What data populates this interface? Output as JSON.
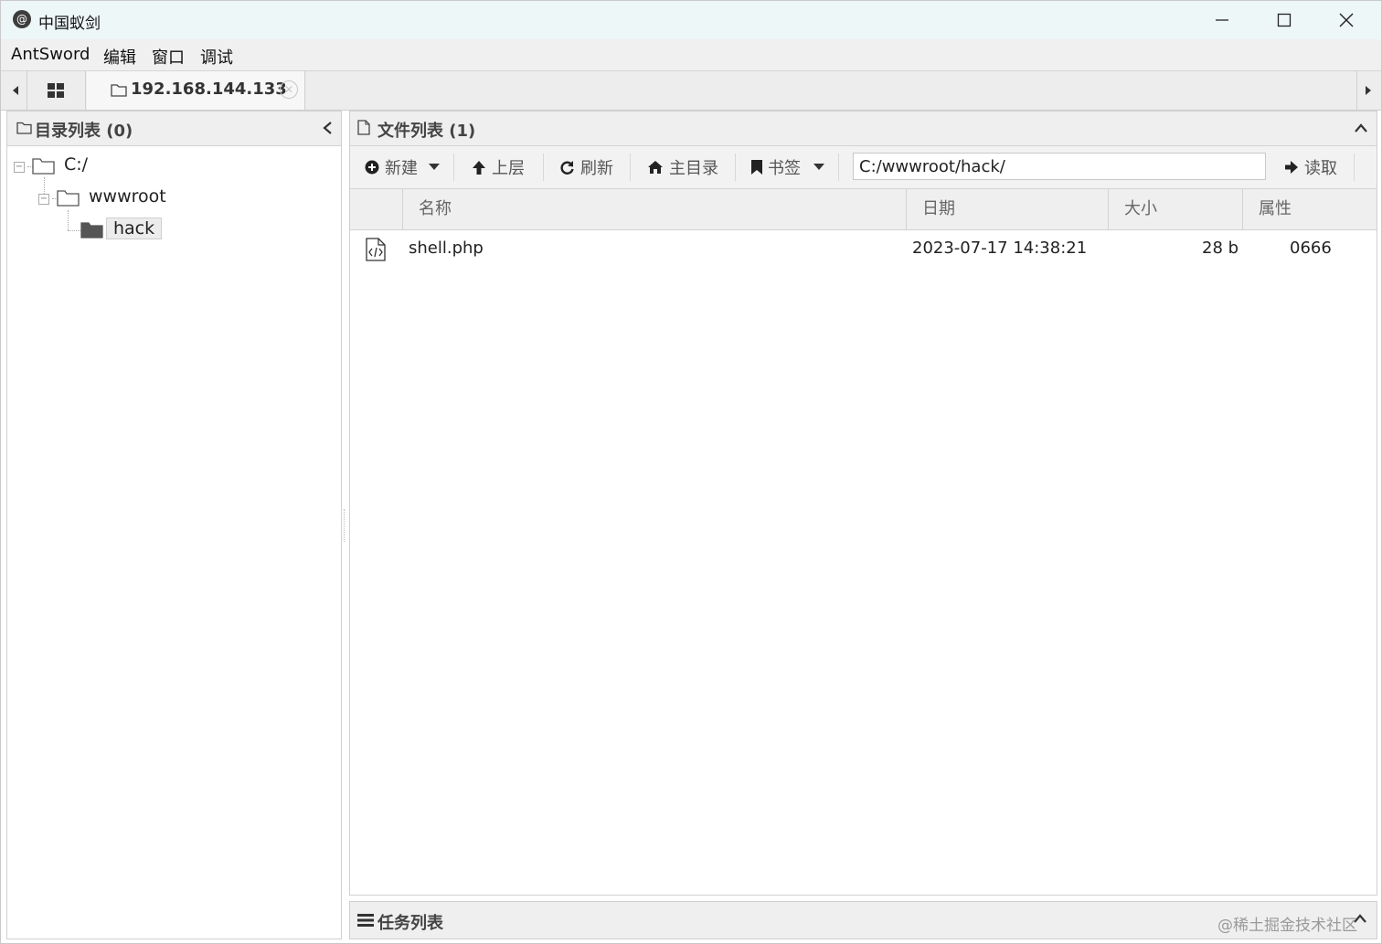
{
  "window": {
    "title": "中国蚁剑",
    "app_icon_glyph": "@"
  },
  "menu": {
    "items": [
      "AntSword",
      "编辑",
      "窗口",
      "调试"
    ]
  },
  "tabs": {
    "active_tab_label": "192.168.144.133"
  },
  "dir_panel": {
    "title": "目录列表 (0)",
    "tree": [
      {
        "label": "C:/"
      },
      {
        "label": "wwwroot"
      },
      {
        "label": "hack"
      }
    ]
  },
  "file_panel": {
    "title": "文件列表 (1)",
    "toolbar": {
      "new_label": "新建",
      "up_label": "上层",
      "refresh_label": "刷新",
      "home_label": "主目录",
      "bookmark_label": "书签",
      "path_value": "C:/wwwroot/hack/",
      "read_label": "读取"
    },
    "columns": {
      "name": "名称",
      "date": "日期",
      "size": "大小",
      "attr": "属性"
    },
    "rows": [
      {
        "name": "shell.php",
        "date": "2023-07-17 14:38:21",
        "size": "28 b",
        "attr": "0666"
      }
    ]
  },
  "task_panel": {
    "title": "任务列表"
  },
  "watermark": "@稀土掘金技术社区"
}
